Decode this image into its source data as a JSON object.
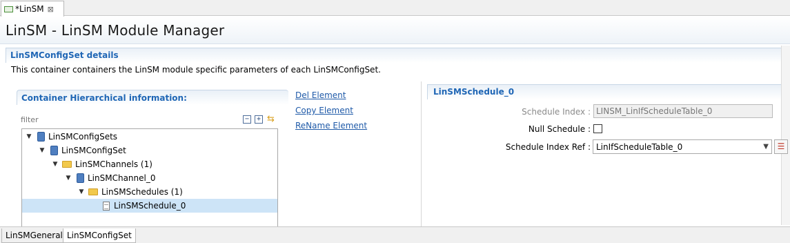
{
  "editor_tab": {
    "label": "*LinSM",
    "close_glyph": "⊠"
  },
  "form": {
    "title": "LinSM - LinSM Module Manager"
  },
  "section": {
    "title": "LinSMConfigSet details",
    "description": "This container containers the LinSM module specific parameters of each LinSMConfigSet."
  },
  "hierarchy": {
    "title": "Container Hierarchical information:",
    "filter_placeholder": "filter",
    "tools": {
      "collapse": "−",
      "expand": "+",
      "sync": "⇆"
    },
    "tree": [
      {
        "label": "LinSMConfigSets",
        "icon": "db-icon",
        "twisty": "v",
        "depth": 0
      },
      {
        "label": "LinSMConfigSet",
        "icon": "db-icon",
        "twisty": "v",
        "depth": 1
      },
      {
        "label": "LinSMChannels (1)",
        "icon": "folder-icon",
        "twisty": "v",
        "depth": 2
      },
      {
        "label": "LinSMChannel_0",
        "icon": "db-icon",
        "twisty": "v",
        "depth": 3
      },
      {
        "label": "LinSMSchedules (1)",
        "icon": "folder-icon",
        "twisty": "v",
        "depth": 4
      },
      {
        "label": "LinSMSchedule_0",
        "icon": "doc-icon",
        "twisty": "",
        "depth": 5,
        "selected": true
      }
    ]
  },
  "actions": {
    "del": "Del Element",
    "copy": "Copy Element",
    "rename": "ReName Element"
  },
  "detail": {
    "title": "LinSMSchedule_0",
    "schedule_index_label": "Schedule Index :",
    "schedule_index_value": "LINSM_LinIfScheduleTable_0",
    "null_schedule_label": "Null Schedule :",
    "null_schedule_checked": false,
    "schedule_index_ref_label": "Schedule Index Ref :",
    "schedule_index_ref_value": "LinIfScheduleTable_0",
    "combo_arrow": "▼",
    "list_button": "☰"
  },
  "bottom_tabs": {
    "general": "LinSMGeneral",
    "configset": "LinSMConfigSet"
  }
}
